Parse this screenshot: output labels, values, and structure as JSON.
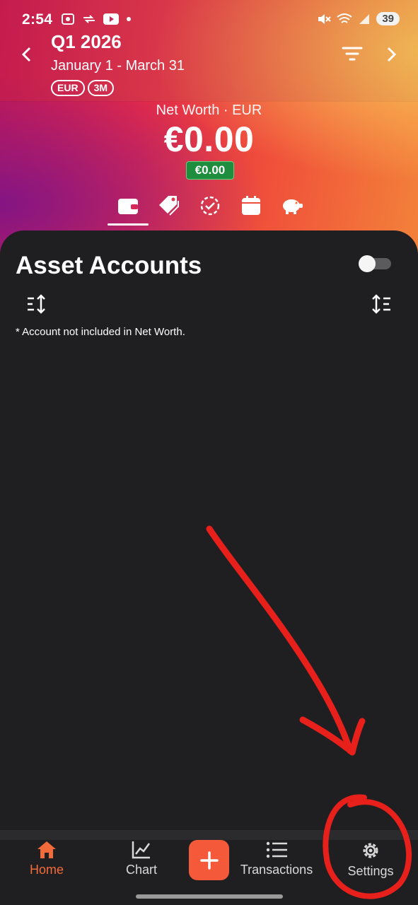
{
  "status_bar": {
    "time": "2:54",
    "battery": "39"
  },
  "header": {
    "period_title": "Q1 2026",
    "period_range": "January 1 - March 31",
    "chips": [
      "EUR",
      "3M"
    ]
  },
  "summary": {
    "label": "Net Worth · EUR",
    "value": "€0.00",
    "change": "€0.00",
    "change_color": "#1e8e3e"
  },
  "view_tabs": [
    "wallet-icon",
    "tags-icon",
    "progress-check-icon",
    "calendar-icon",
    "piggy-bank-icon"
  ],
  "accounts": {
    "title": "Asset Accounts",
    "footnote": "* Account not included in Net Worth."
  },
  "bottom_nav": {
    "home": "Home",
    "chart": "Chart",
    "transactions": "Transactions",
    "settings": "Settings",
    "accent": "#f4593a"
  },
  "annotation_color": "#e8201c"
}
